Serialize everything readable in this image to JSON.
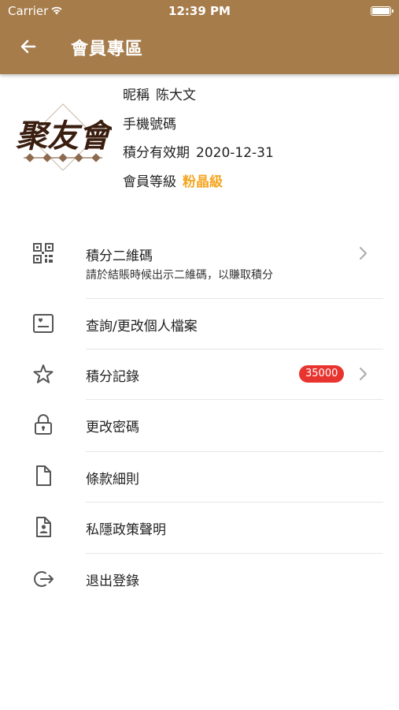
{
  "status_bar": {
    "carrier": "Carrier",
    "time": "12:39 PM"
  },
  "header": {
    "title": "會員專區"
  },
  "profile": {
    "nickname_label": "昵稱",
    "nickname_value": "陈大文",
    "phone_label": "手機號碼",
    "phone_value": "",
    "expiry_label": "積分有效期",
    "expiry_value": "2020-12-31",
    "level_label": "會員等級",
    "level_value": "粉晶級",
    "level_color": "#f5a623",
    "logo_text": "聚友會"
  },
  "menu": {
    "points_qr": {
      "label": "積分二維碼",
      "sub": "請於結賬時候出示二維碼，以賺取積分",
      "icon": "qr-code-icon"
    },
    "profile": {
      "label": "查詢/更改個人檔案",
      "icon": "id-card-icon"
    },
    "points_log": {
      "label": "積分記錄",
      "badge": "35000",
      "icon": "star-icon"
    },
    "password": {
      "label": "更改密碼",
      "icon": "lock-icon"
    },
    "terms": {
      "label": "條款細則",
      "icon": "document-icon"
    },
    "privacy": {
      "label": "私隱政策聲明",
      "icon": "user-document-icon"
    },
    "logout": {
      "label": "退出登錄",
      "icon": "logout-icon"
    }
  },
  "colors": {
    "header": "#a67c4a",
    "badge": "#e8342f"
  }
}
